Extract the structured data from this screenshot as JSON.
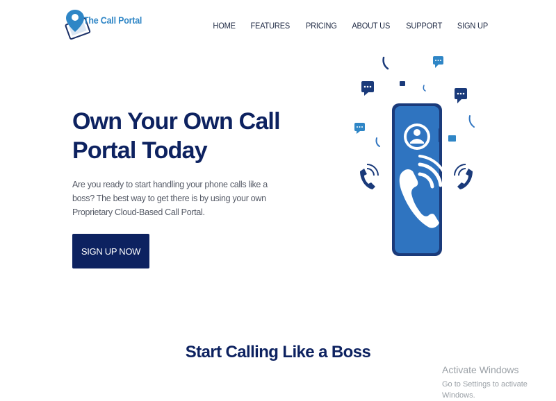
{
  "header": {
    "logo_text": "The Call Portal",
    "nav": [
      {
        "label": "HOME"
      },
      {
        "label": "FEATURES"
      },
      {
        "label": "PRICING"
      },
      {
        "label": "ABOUT US"
      },
      {
        "label": "SUPPORT"
      },
      {
        "label": "SIGN UP"
      }
    ]
  },
  "hero": {
    "title_line1": "Own Your Own Call",
    "title_line2": "Portal Today",
    "description": "Are you ready to start handling your phone calls like a boss?  The best way to get there is by using your own Proprietary  Cloud-Based Call Portal.",
    "cta_label": "SIGN UP NOW"
  },
  "section": {
    "title": "Start Calling Like a Boss"
  },
  "watermark": {
    "line1": "Activate Windows",
    "line2": "Go to Settings to activate Windows."
  },
  "colors": {
    "brand_navy": "#0d2260",
    "brand_blue": "#2f86c6",
    "illustration_blue": "#2f74c0"
  },
  "icons": [
    "map-pin-icon",
    "phone-icon",
    "chat-bubble-icon",
    "user-icon",
    "ringing-phone-icon"
  ]
}
